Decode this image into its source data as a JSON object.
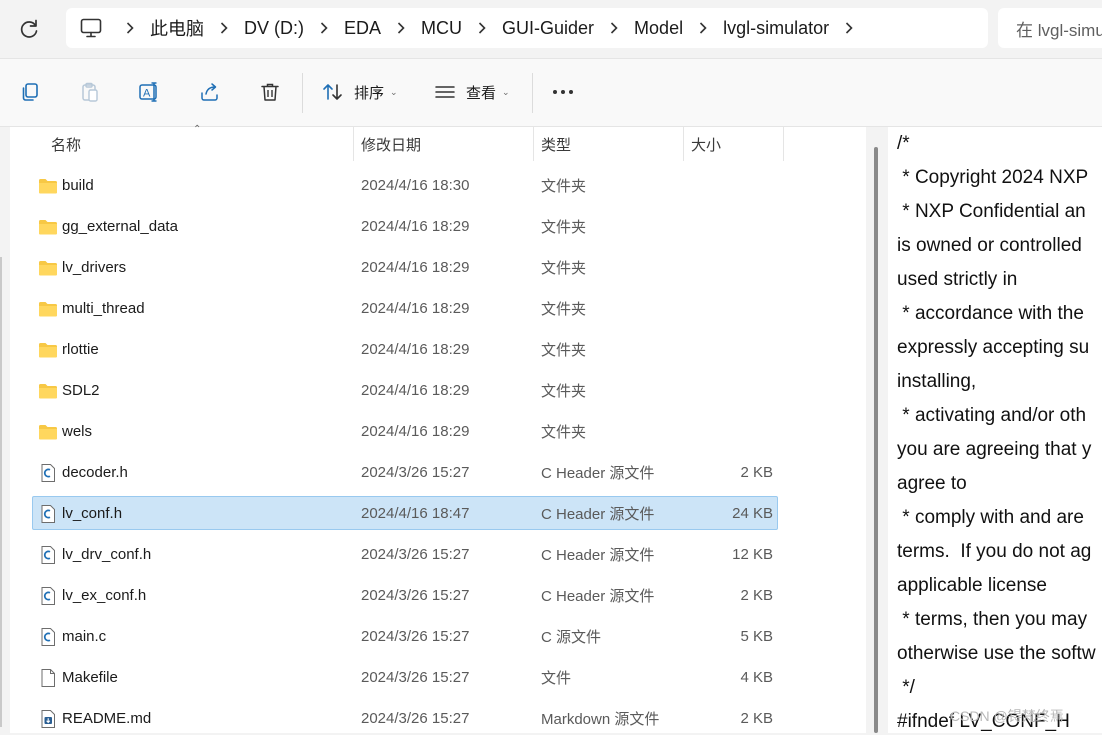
{
  "breadcrumb": [
    "此电脑",
    "DV (D:)",
    "EDA",
    "MCU",
    "GUI-Guider",
    "Model",
    "lvgl-simulator"
  ],
  "search": {
    "placeholder": "在 lvgl-simulator 中搜索"
  },
  "toolbar": {
    "sort_label": "排序",
    "view_label": "查看"
  },
  "columns": {
    "name": "名称",
    "date": "修改日期",
    "type": "类型",
    "size": "大小"
  },
  "files": [
    {
      "name": "build",
      "date": "2024/4/16 18:30",
      "type": "文件夹",
      "size": "",
      "icon": "folder-icon"
    },
    {
      "name": "gg_external_data",
      "date": "2024/4/16 18:29",
      "type": "文件夹",
      "size": "",
      "icon": "folder-icon"
    },
    {
      "name": "lv_drivers",
      "date": "2024/4/16 18:29",
      "type": "文件夹",
      "size": "",
      "icon": "folder-icon"
    },
    {
      "name": "multi_thread",
      "date": "2024/4/16 18:29",
      "type": "文件夹",
      "size": "",
      "icon": "folder-icon"
    },
    {
      "name": "rlottie",
      "date": "2024/4/16 18:29",
      "type": "文件夹",
      "size": "",
      "icon": "folder-icon"
    },
    {
      "name": "SDL2",
      "date": "2024/4/16 18:29",
      "type": "文件夹",
      "size": "",
      "icon": "folder-icon"
    },
    {
      "name": "wels",
      "date": "2024/4/16 18:29",
      "type": "文件夹",
      "size": "",
      "icon": "folder-icon"
    },
    {
      "name": "decoder.h",
      "date": "2024/3/26 15:27",
      "type": "C Header 源文件",
      "size": "2 KB",
      "icon": "c-file-icon"
    },
    {
      "name": "lv_conf.h",
      "date": "2024/4/16 18:47",
      "type": "C Header 源文件",
      "size": "24 KB",
      "icon": "c-file-icon",
      "selected": true
    },
    {
      "name": "lv_drv_conf.h",
      "date": "2024/3/26 15:27",
      "type": "C Header 源文件",
      "size": "12 KB",
      "icon": "c-file-icon"
    },
    {
      "name": "lv_ex_conf.h",
      "date": "2024/3/26 15:27",
      "type": "C Header 源文件",
      "size": "2 KB",
      "icon": "c-file-icon"
    },
    {
      "name": "main.c",
      "date": "2024/3/26 15:27",
      "type": "C 源文件",
      "size": "5 KB",
      "icon": "c-file-icon"
    },
    {
      "name": "Makefile",
      "date": "2024/3/26 15:27",
      "type": "文件",
      "size": "4 KB",
      "icon": "blank-file-icon"
    },
    {
      "name": "README.md",
      "date": "2024/3/26 15:27",
      "type": "Markdown 源文件",
      "size": "2 KB",
      "icon": "markdown-file-icon"
    }
  ],
  "preview_lines": [
    "/*",
    " * Copyright 2024 NXP",
    " * NXP Confidential an",
    "is owned or controlled",
    "used strictly in",
    " * accordance with the",
    "expressly accepting su",
    "installing,",
    " * activating and/or oth",
    "you are agreeing that y",
    "agree to",
    " * comply with and are",
    "terms.  If you do not ag",
    "applicable license",
    " * terms, then you may",
    "otherwise use the softw",
    " */",
    "#ifndef LV_CONF_H"
  ],
  "watermark": "CSDN @锝梵终焉",
  "colors": {
    "selection_bg": "#cce4f7",
    "selection_border": "#99c9ef",
    "folder": "#f7c845",
    "c_file": "#1f6fb5"
  }
}
